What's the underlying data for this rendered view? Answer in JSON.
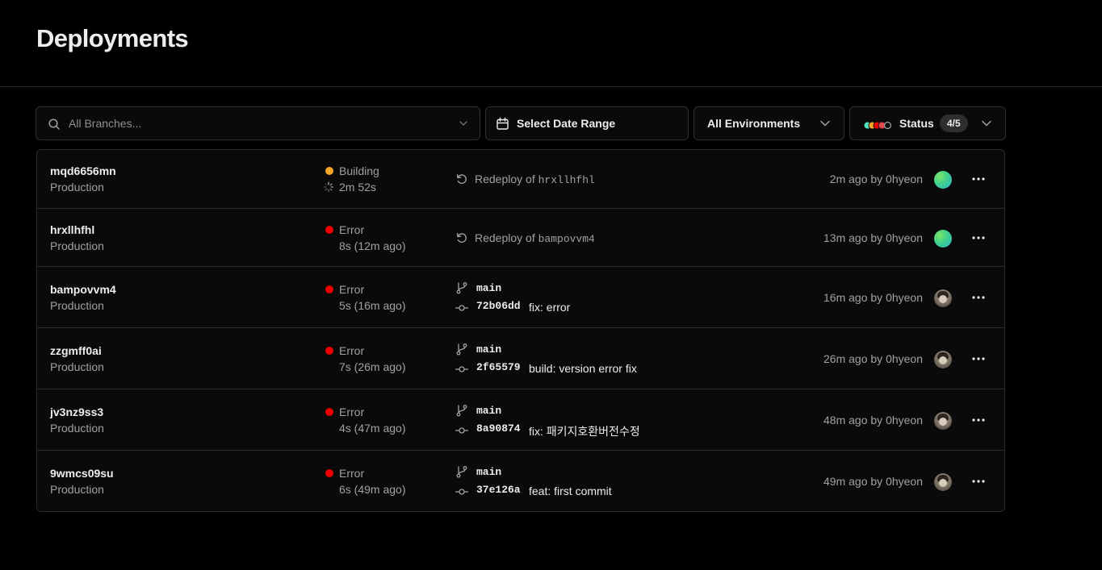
{
  "header": {
    "title": "Deployments"
  },
  "filters": {
    "branch_placeholder": "All Branches...",
    "date_label": "Select Date Range",
    "environment_label": "All Environments",
    "status_label": "Status",
    "status_count": "4/5",
    "status_colors": [
      "#50e3c2",
      "#f5a623",
      "#ee0000",
      "#e5484d",
      "#a1a1a1"
    ]
  },
  "colors": {
    "building": "#f5a623",
    "error": "#ee0000"
  },
  "deployments": [
    {
      "id": "mqd6656mn",
      "environment": "Production",
      "status": "Building",
      "duration": "2m 52s",
      "type": "redeploy",
      "redeploy_prefix": "Redeploy of",
      "redeploy_of": "hrxllhfhl",
      "meta": "2m ago by 0hyeon",
      "avatar": "gradient"
    },
    {
      "id": "hrxllhfhl",
      "environment": "Production",
      "status": "Error",
      "duration": "8s (12m ago)",
      "type": "redeploy",
      "redeploy_prefix": "Redeploy of",
      "redeploy_of": "bampovvm4",
      "meta": "13m ago by 0hyeon",
      "avatar": "gradient"
    },
    {
      "id": "bampovvm4",
      "environment": "Production",
      "status": "Error",
      "duration": "5s (16m ago)",
      "type": "commit",
      "branch": "main",
      "commit_hash": "72b06dd",
      "commit_message": "fix: error",
      "meta": "16m ago by 0hyeon",
      "avatar": "photo"
    },
    {
      "id": "zzgmff0ai",
      "environment": "Production",
      "status": "Error",
      "duration": "7s (26m ago)",
      "type": "commit",
      "branch": "main",
      "commit_hash": "2f65579",
      "commit_message": "build: version error fix",
      "meta": "26m ago by 0hyeon",
      "avatar": "photo"
    },
    {
      "id": "jv3nz9ss3",
      "environment": "Production",
      "status": "Error",
      "duration": "4s (47m ago)",
      "type": "commit",
      "branch": "main",
      "commit_hash": "8a90874",
      "commit_message": "fix: 패키지호환버전수정",
      "meta": "48m ago by 0hyeon",
      "avatar": "photo"
    },
    {
      "id": "9wmcs09su",
      "environment": "Production",
      "status": "Error",
      "duration": "6s (49m ago)",
      "type": "commit",
      "branch": "main",
      "commit_hash": "37e126a",
      "commit_message": "feat: first commit",
      "meta": "49m ago by 0hyeon",
      "avatar": "photo"
    }
  ]
}
